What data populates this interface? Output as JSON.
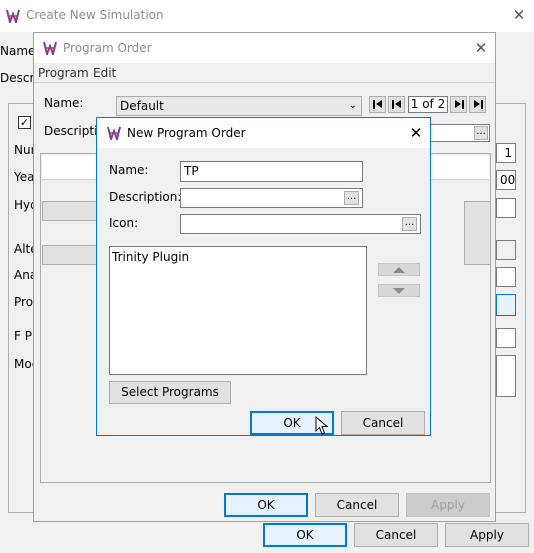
{
  "outer": {
    "title": "Create New Simulation",
    "labels": {
      "name": "Name",
      "description": "Descr",
      "number": "Nur",
      "year": "Yea",
      "hydro": "Hyd",
      "alternative": "Alte",
      "analysis": "Ana",
      "program": "Pro",
      "fpart": "F P",
      "model": "Moc"
    },
    "right_values": {
      "v1": "1",
      "v2": "00"
    },
    "buttons": {
      "ok": "OK",
      "cancel": "Cancel",
      "apply": "Apply"
    }
  },
  "program_order": {
    "title": "Program Order",
    "menu": [
      "Program",
      "Edit"
    ],
    "name_label": "Name:",
    "name_value": "Default",
    "description_label": "Descriptio",
    "page_indicator": "1 of 2",
    "buttons": {
      "ok": "OK",
      "cancel": "Cancel",
      "apply": "Apply"
    }
  },
  "new_program_order": {
    "title": "New Program Order",
    "name_label": "Name:",
    "name_value": "TP",
    "description_label": "Description:",
    "description_value": "",
    "icon_label": "Icon:",
    "icon_value": "",
    "list_items": [
      "Trinity Plugin"
    ],
    "select_programs_label": "Select Programs",
    "ok_label": "OK",
    "cancel_label": "Cancel",
    "ellipsis": "..."
  },
  "colors": {
    "accent": "#0078d7",
    "window_bg": "#f0f0f0",
    "title_bg": "#ffffff"
  }
}
